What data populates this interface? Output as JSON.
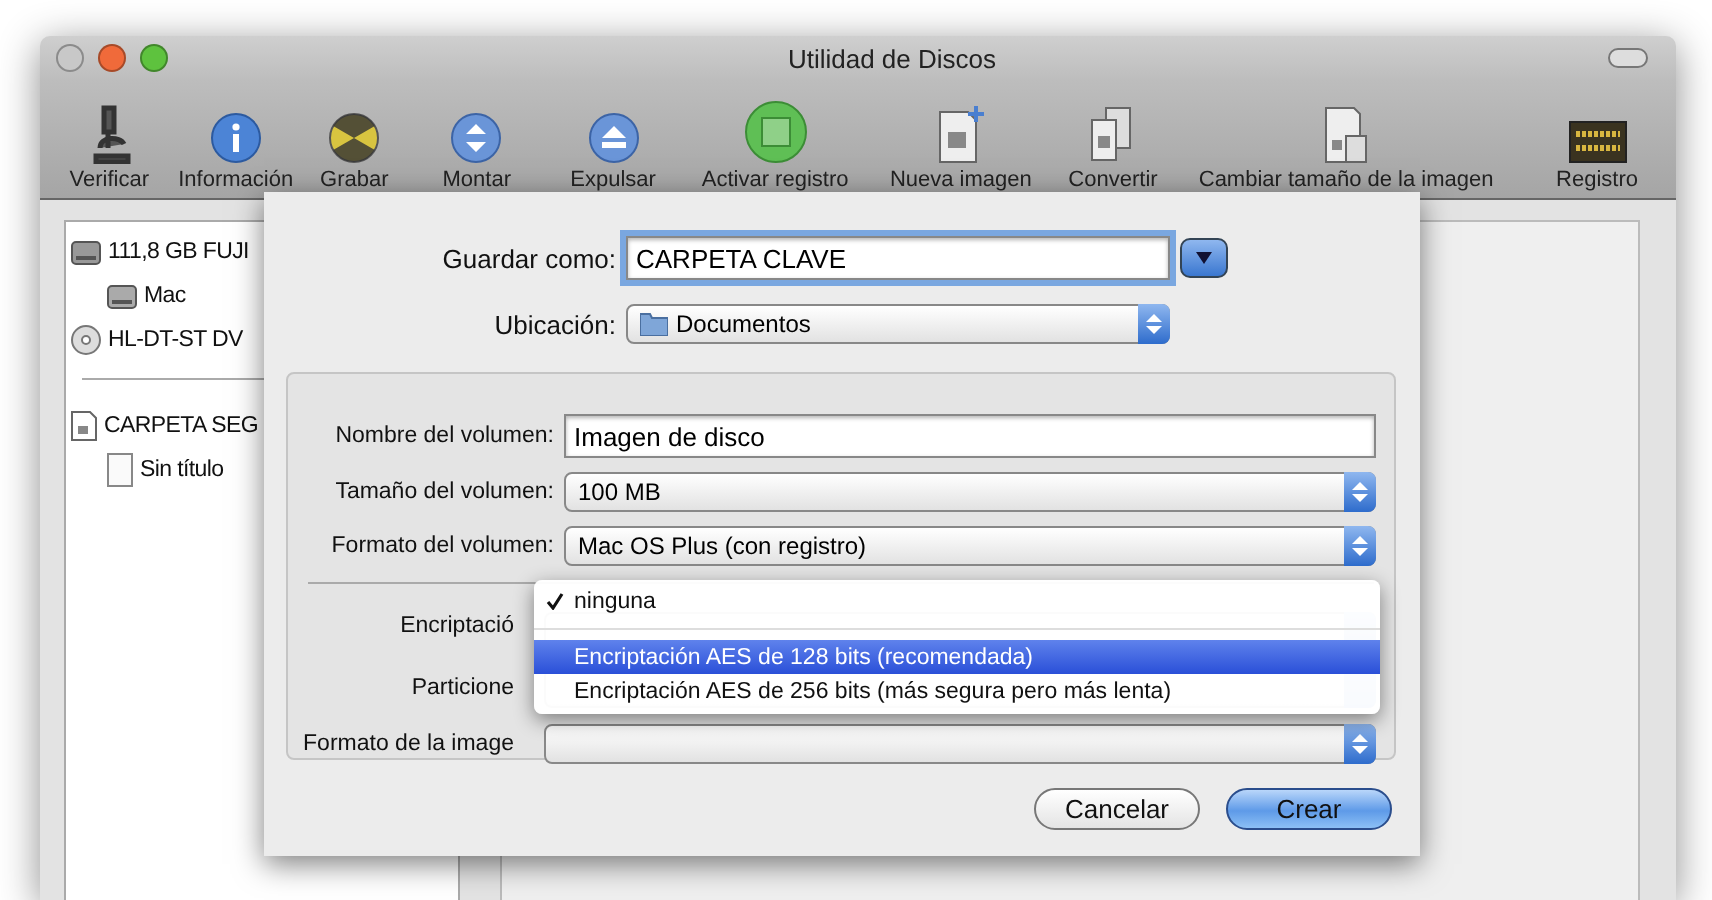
{
  "window": {
    "title": "Utilidad de Discos"
  },
  "toolbar": [
    {
      "label": "Verificar"
    },
    {
      "label": "Información"
    },
    {
      "label": "Grabar"
    },
    {
      "label": "Montar"
    },
    {
      "label": "Expulsar"
    },
    {
      "label": "Activar registro"
    },
    {
      "label": "Nueva imagen"
    },
    {
      "label": "Convertir"
    },
    {
      "label": "Cambiar tamaño de la imagen"
    },
    {
      "label": "Registro"
    }
  ],
  "sidebar": {
    "groups": [
      [
        {
          "label": "111,8 GB FUJI",
          "kind": "disk",
          "children": [
            {
              "label": "Mac",
              "kind": "volume"
            }
          ]
        },
        {
          "label": "HL-DT-ST DV",
          "kind": "optical"
        }
      ],
      [
        {
          "label": "CARPETA SEG",
          "kind": "image",
          "children": [
            {
              "label": "Sin título",
              "kind": "blank"
            }
          ]
        }
      ]
    ]
  },
  "sheet": {
    "save_as": {
      "label": "Guardar como:",
      "value": "CARPETA CLAVE"
    },
    "location": {
      "label": "Ubicación:",
      "value": "Documentos"
    },
    "volume_fields": [
      {
        "label": "Nombre del volumen:",
        "kind": "text",
        "value": "Imagen de disco"
      },
      {
        "label": "Tamaño del volumen:",
        "kind": "popup",
        "value": "100 MB"
      },
      {
        "label": "Formato del volumen:",
        "kind": "popup",
        "value": "Mac OS Plus (con registro)"
      }
    ],
    "image_fields": [
      {
        "label": "Encriptació"
      },
      {
        "label": "Particione"
      },
      {
        "label": "Formato de la image"
      }
    ],
    "menu": [
      {
        "label": "ninguna",
        "checked": true,
        "selected": false
      },
      {
        "label": "Encriptación AES de 128 bits (recomendada)",
        "checked": false,
        "selected": true
      },
      {
        "label": "Encriptación AES de 256 bits (más segura pero más lenta)",
        "checked": false,
        "selected": false
      }
    ],
    "buttons": [
      {
        "label": "Cancelar",
        "default": false
      },
      {
        "label": "Crear",
        "default": true
      }
    ]
  }
}
